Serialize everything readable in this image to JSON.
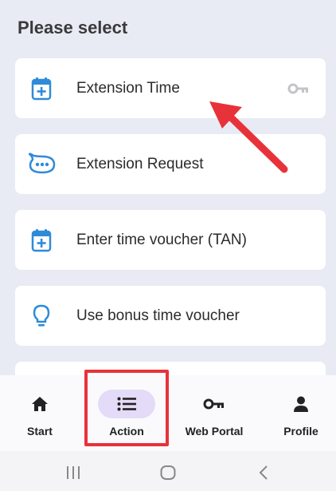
{
  "heading": "Please select",
  "options": [
    {
      "label": "Extension Time",
      "icon": "calendar-plus-icon",
      "trailing_icon": "key-icon"
    },
    {
      "label": "Extension Request",
      "icon": "chat-bubble-icon"
    },
    {
      "label": "Enter time voucher (TAN)",
      "icon": "calendar-plus-icon"
    },
    {
      "label": "Use bonus time voucher",
      "icon": "lightbulb-icon"
    }
  ],
  "nav": [
    {
      "label": "Start",
      "icon": "home-icon"
    },
    {
      "label": "Action",
      "icon": "list-icon",
      "active": true
    },
    {
      "label": "Web Portal",
      "icon": "key-icon"
    },
    {
      "label": "Profile",
      "icon": "person-icon"
    }
  ],
  "colors": {
    "background": "#e8ebf4",
    "accent": "#2f8bd8",
    "highlight": "#e8323a",
    "active_pill": "#e4dbf8"
  }
}
